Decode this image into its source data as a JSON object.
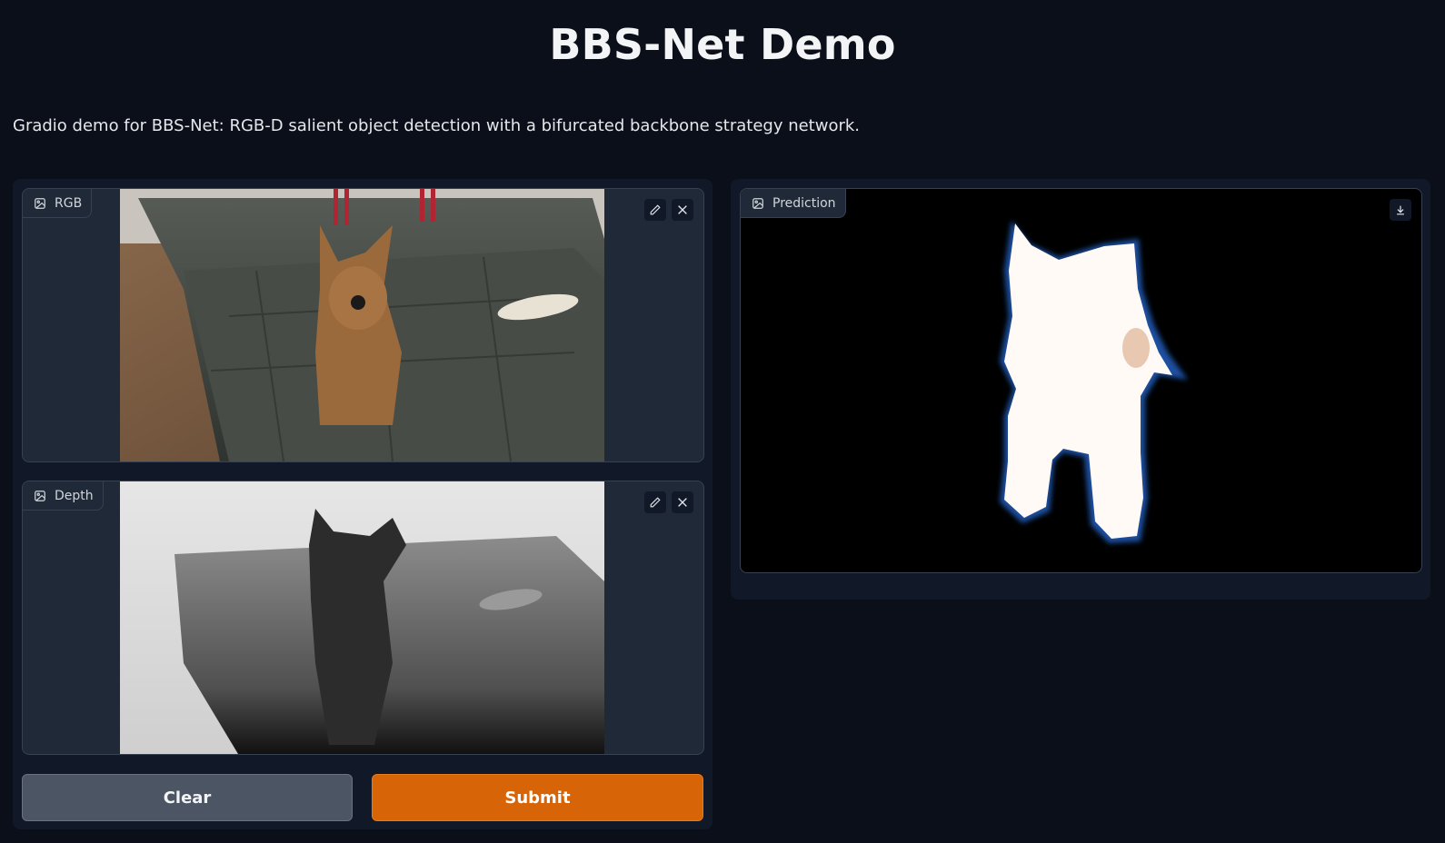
{
  "header": {
    "title": "BBS-Net Demo",
    "description": "Gradio demo for BBS-Net: RGB-D salient object detection with a bifurcated backbone strategy network."
  },
  "inputs": {
    "rgb": {
      "label": "RGB",
      "icon": "image-icon",
      "tools": [
        "pencil-icon",
        "close-icon"
      ]
    },
    "depth": {
      "label": "Depth",
      "icon": "image-icon",
      "tools": [
        "pencil-icon",
        "close-icon"
      ]
    }
  },
  "outputs": {
    "prediction": {
      "label": "Prediction",
      "icon": "image-icon",
      "tools": [
        "download-icon"
      ]
    }
  },
  "actions": {
    "clear_label": "Clear",
    "submit_label": "Submit"
  },
  "colors": {
    "background": "#0b0f19",
    "panel": "#1f2937",
    "submit": "#d76406",
    "clear": "#4b5563"
  }
}
